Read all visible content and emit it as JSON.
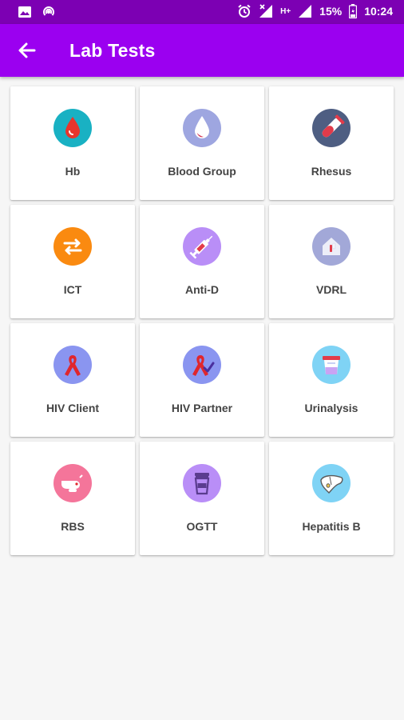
{
  "status_bar": {
    "battery": "15%",
    "time": "10:24",
    "network": "H+"
  },
  "app_bar": {
    "title": "Lab Tests"
  },
  "tests": [
    {
      "label": "Hb",
      "icon": "blood-drop-icon",
      "color": "#19b1c3"
    },
    {
      "label": "Blood Group",
      "icon": "blood-group-drop-icon",
      "color": "#9ea6e0"
    },
    {
      "label": "Rhesus",
      "icon": "test-tube-icon",
      "color": "#4e5e82"
    },
    {
      "label": "ICT",
      "icon": "swap-arrows-icon",
      "color": "#fa8a10"
    },
    {
      "label": "Anti-D",
      "icon": "syringe-icon",
      "color": "#b98ef7"
    },
    {
      "label": "VDRL",
      "icon": "house-test-icon",
      "color": "#a2a8d8"
    },
    {
      "label": "HIV Client",
      "icon": "awareness-ribbon-icon",
      "color": "#8a95f0"
    },
    {
      "label": "HIV Partner",
      "icon": "ribbon-check-icon",
      "color": "#8a95f0"
    },
    {
      "label": "Urinalysis",
      "icon": "urine-cup-icon",
      "color": "#7fd3f5"
    },
    {
      "label": "RBS",
      "icon": "finger-prick-icon",
      "color": "#f4759a"
    },
    {
      "label": "OGTT",
      "icon": "glucose-cup-icon",
      "color": "#b98ef7"
    },
    {
      "label": "Hepatitis B",
      "icon": "liver-icon",
      "color": "#7fd3f5"
    }
  ]
}
